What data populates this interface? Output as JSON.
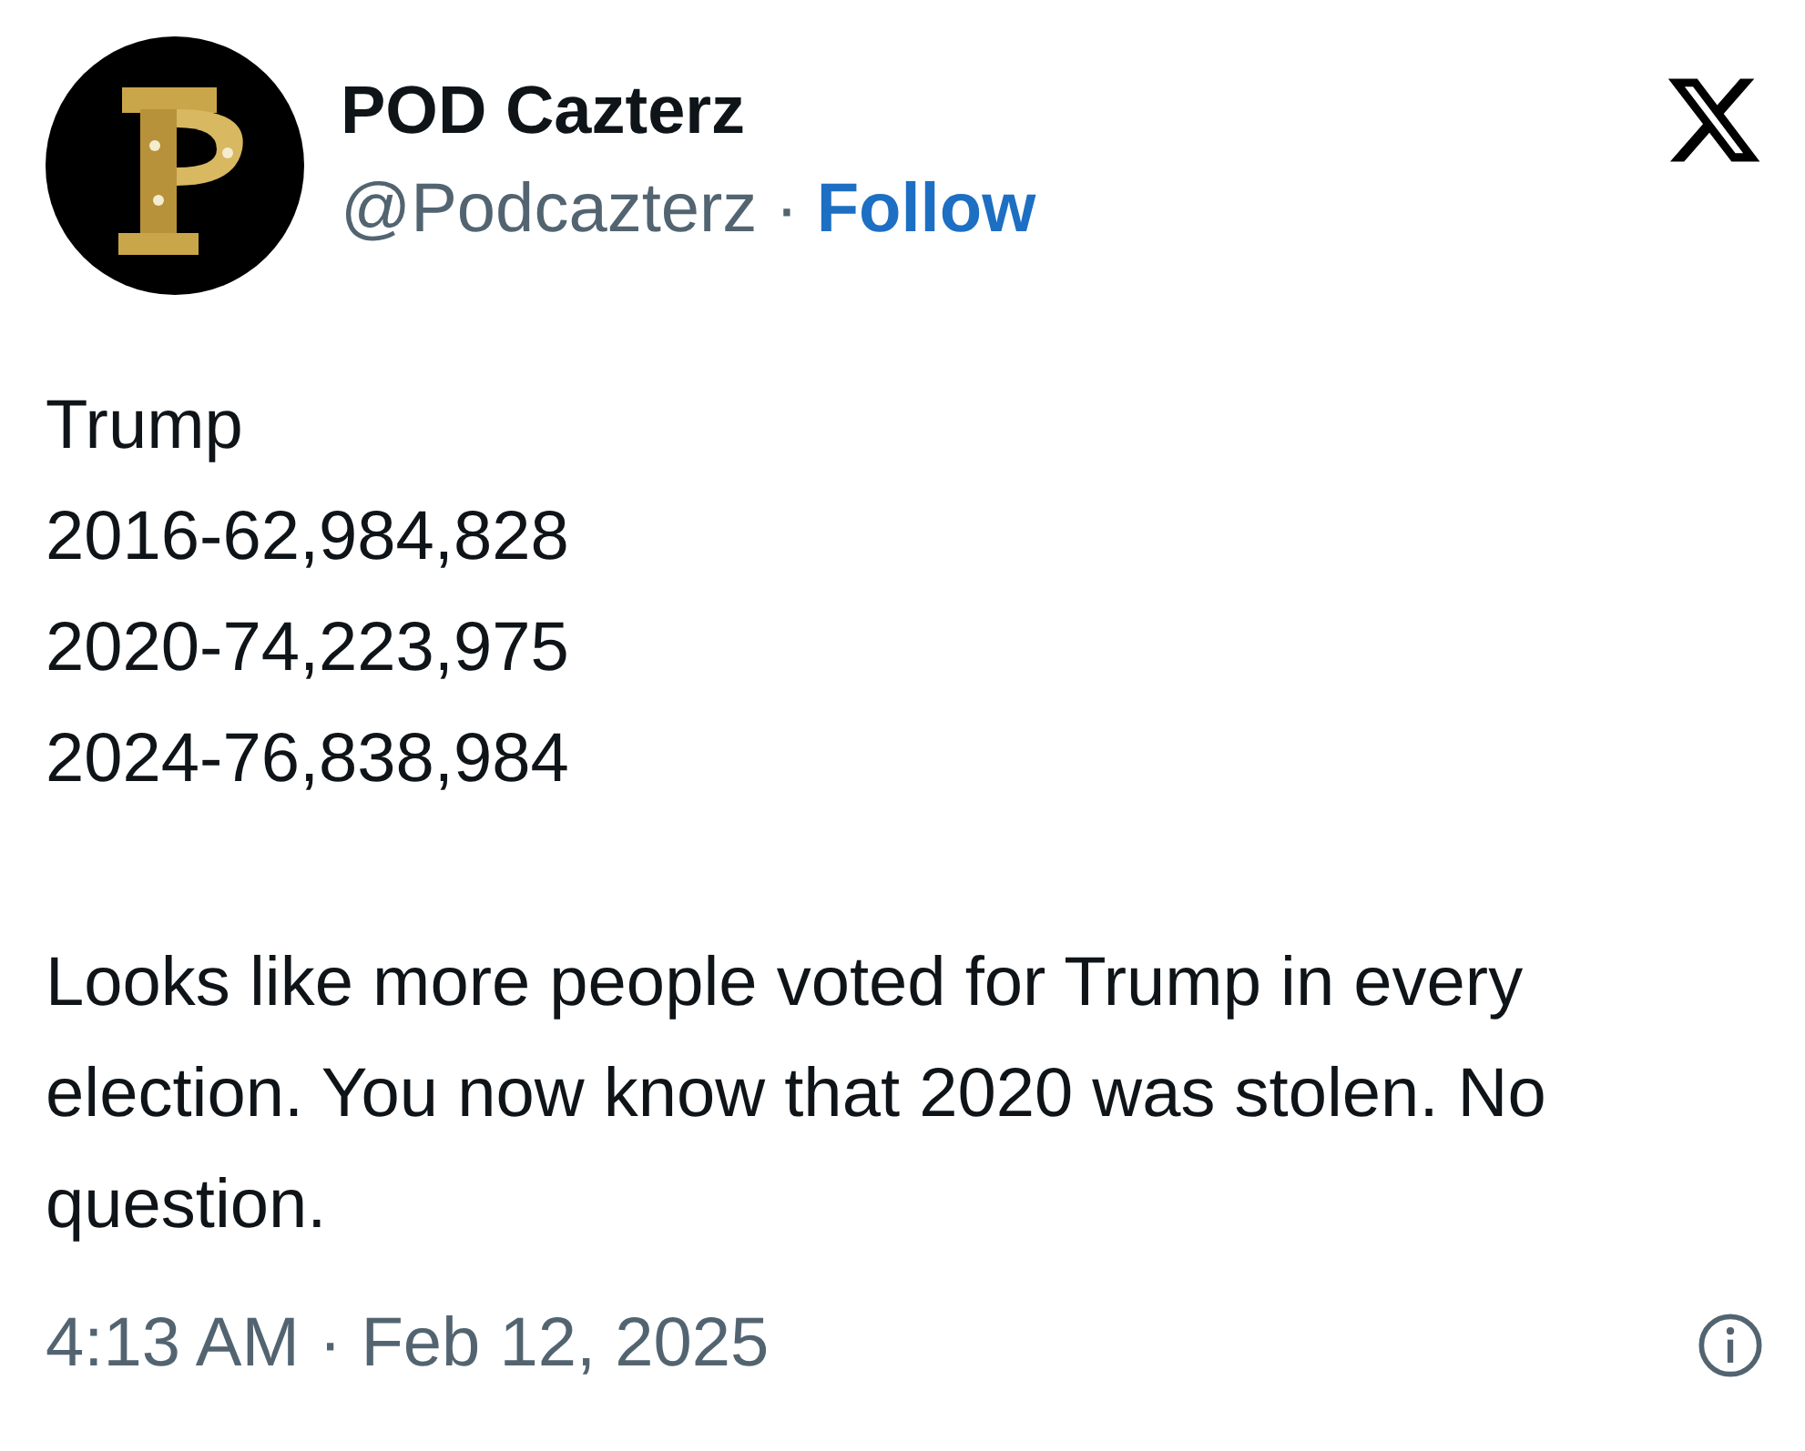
{
  "author": {
    "name": "POD Cazterz",
    "handle": "@Podcazterz",
    "separator": "·",
    "follow": "Follow"
  },
  "body": {
    "lines": [
      "Trump",
      "2016-62,984,828",
      "2020-74,223,975",
      "2024-76,838,984"
    ],
    "paragraph": "Looks like more people voted for Trump in every election. You now know that 2020 was stolen. No question."
  },
  "timestamp": "4:13 AM · Feb 12, 2025"
}
